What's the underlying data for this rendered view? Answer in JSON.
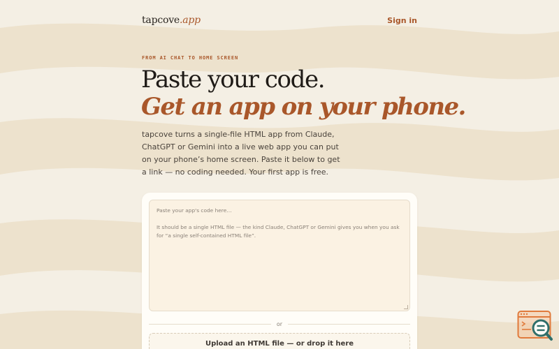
{
  "header": {
    "logo_text": "tapcove",
    "logo_suffix": ".app",
    "signin_label": "Sign in"
  },
  "hero": {
    "eyebrow": "FROM AI CHAT TO HOME SCREEN",
    "headline": "Paste your code.",
    "headline_accent": "Get an app on your phone.",
    "lede": "tapcove turns a single-file HTML app from Claude, ChatGPT or Gemini into a live web app you can put on your phone’s home screen. Paste it below to get a link — no coding needed. Your first app is free."
  },
  "editor": {
    "placeholder_line1": "Paste your app's code here…",
    "placeholder_line2": "It should be a single HTML file — the kind Claude, ChatGPT or Gemini gives you when you ask for “a single self-contained HTML file”.",
    "divider_text": "or",
    "upload_label": "Upload an HTML file — or drop it here"
  },
  "icons": {
    "floating_widget": "code-window-search-icon"
  },
  "colors": {
    "accent": "#a9572a",
    "background": "#f4efe4",
    "card": "#fffdf8",
    "teal": "#2f6f6a"
  }
}
